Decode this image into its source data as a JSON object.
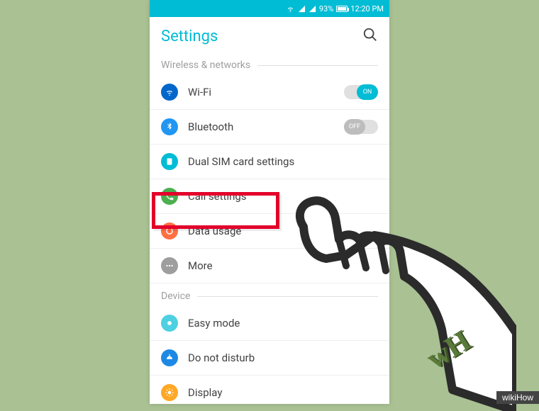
{
  "status": {
    "battery_pct": "93%",
    "time": "12:20 PM"
  },
  "header": {
    "title": "Settings"
  },
  "sections": {
    "wireless": {
      "title": "Wireless & networks",
      "wifi": {
        "label": "Wi-Fi",
        "toggle": "ON"
      },
      "bluetooth": {
        "label": "Bluetooth",
        "toggle": "OFF"
      },
      "dualsim": {
        "label": "Dual SIM card settings"
      },
      "call": {
        "label": "Call settings"
      },
      "data": {
        "label": "Data usage"
      },
      "more": {
        "label": "More"
      }
    },
    "device": {
      "title": "Device",
      "easy": {
        "label": "Easy mode"
      },
      "dnd": {
        "label": "Do not disturb"
      },
      "display": {
        "label": "Display"
      }
    }
  },
  "branding": {
    "logo": "wH",
    "tag": "wikiHow"
  },
  "colors": {
    "accent": "#00bcd4",
    "wifi_icon": "#0066cc",
    "bluetooth_icon": "#2196f3",
    "dualsim_icon": "#00bcd4",
    "call_icon": "#4caf50",
    "data_icon": "#ff7043",
    "more_icon": "#9e9e9e",
    "easy_icon": "#4dd0e1",
    "dnd_icon": "#1e88e5",
    "display_icon": "#ffa726",
    "highlight": "#e3002b"
  }
}
